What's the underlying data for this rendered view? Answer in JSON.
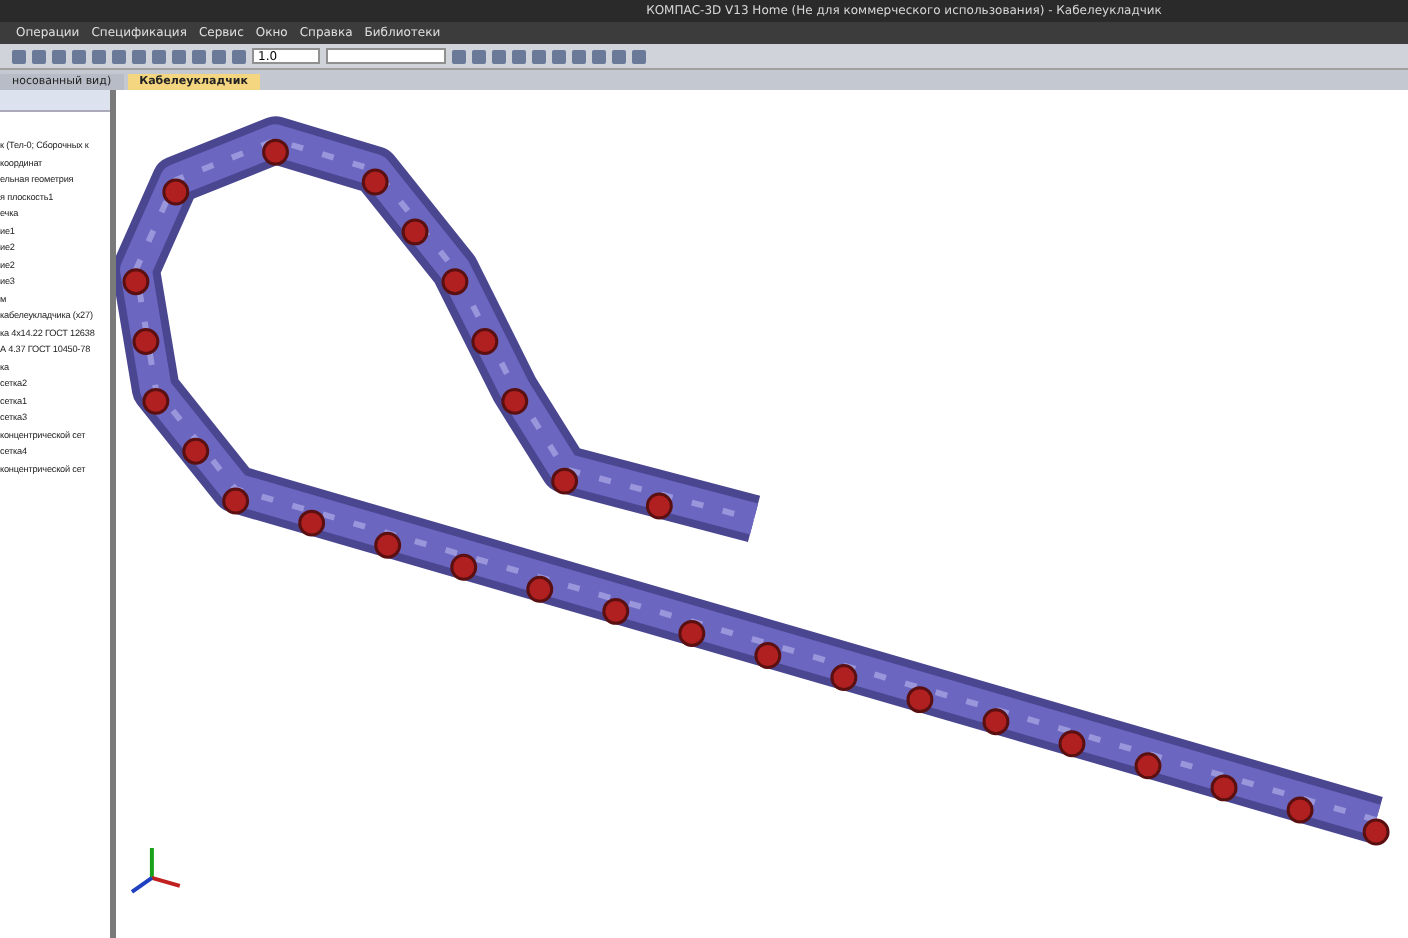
{
  "window": {
    "title": "КОМПАС-3D V13 Home (Не для коммерческого использования) - Кабелеукладчик"
  },
  "menu": [
    "Операции",
    "Спецификация",
    "Сервис",
    "Окно",
    "Справка",
    "Библиотеки"
  ],
  "toolbar": {
    "scale_field": "1.0"
  },
  "tabs": [
    {
      "label": "носованный вид)",
      "selected": false
    },
    {
      "label": "Кабелеукладчик",
      "selected": true
    }
  ],
  "tree": {
    "items": [
      "к (Тел-0; Сборочных к",
      "координат",
      "ельная геометрия",
      "я плоскость1",
      "ечка",
      "ие1",
      "ие2",
      "ие2",
      "ие3",
      "м",
      "кабелеукладчика (х27)",
      "ка 4х14.22 ГОСТ 12638",
      "А 4.37 ГОСТ 10450-78",
      "ка",
      "сетка2",
      "сетка1",
      "сетка3",
      "концентрической сет",
      "сетка4",
      "концентрической сет"
    ]
  }
}
